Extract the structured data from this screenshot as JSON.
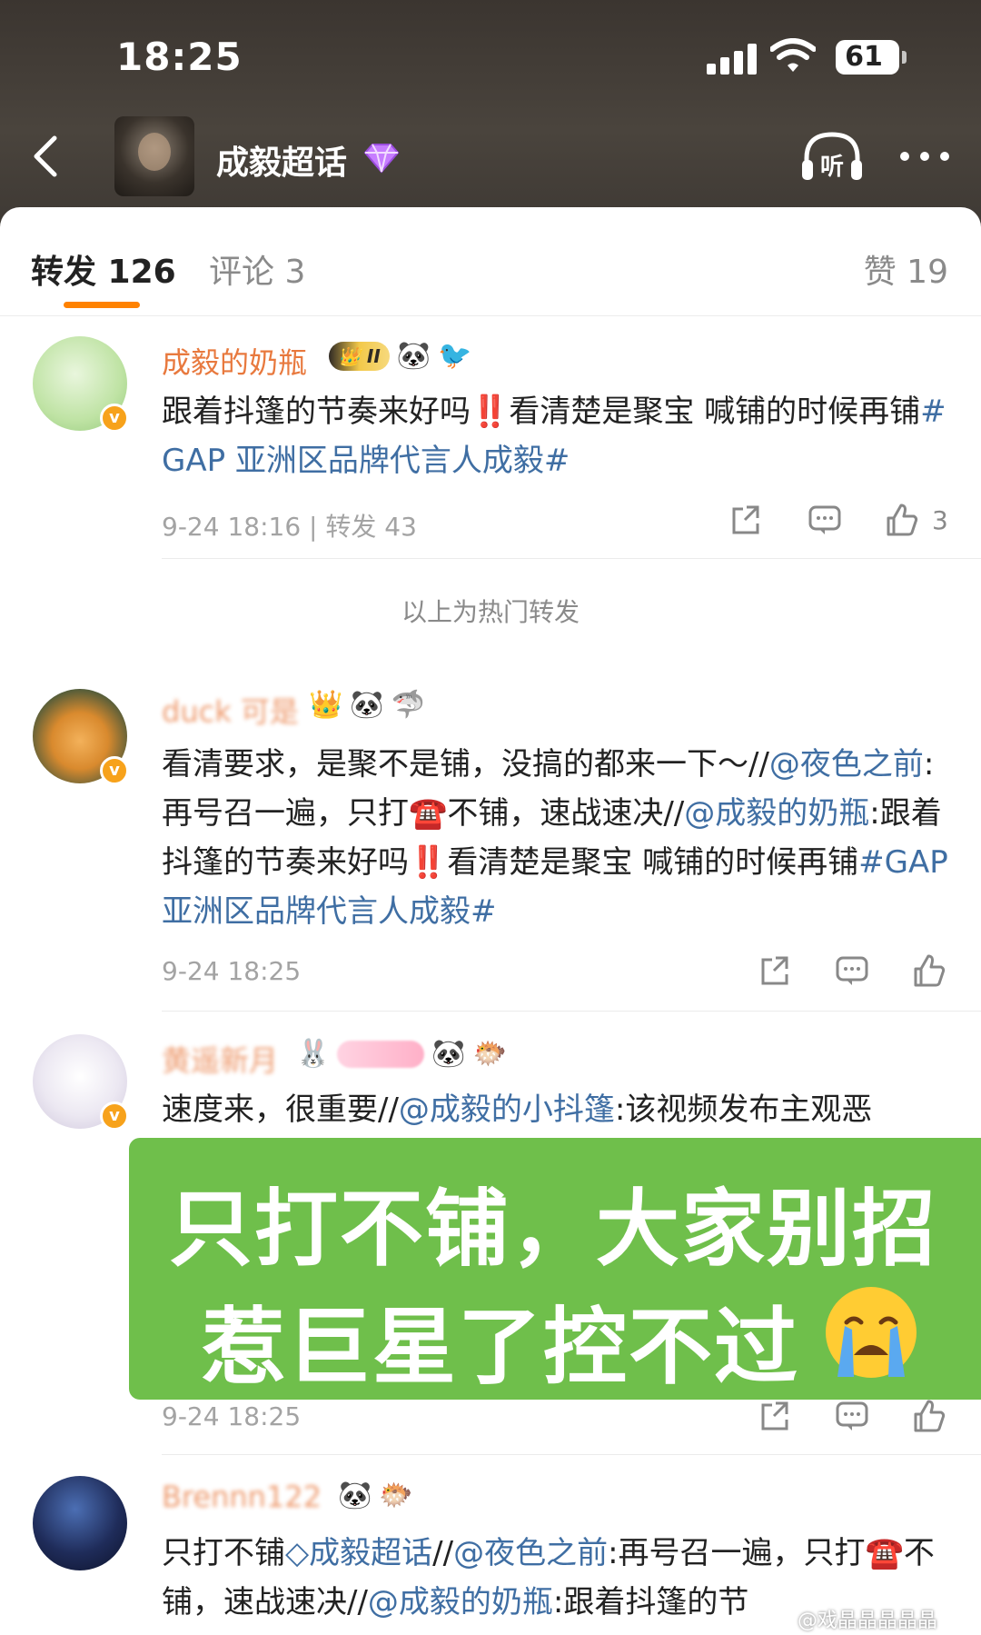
{
  "status_bar": {
    "time": "18:25",
    "battery": "61"
  },
  "nav": {
    "title": "成毅超话",
    "listen_label": "听"
  },
  "tabs": {
    "repost": "转发 126",
    "comment": "评论 3",
    "like": "赞 19"
  },
  "hot_divider": "以上为热门转发",
  "posts": [
    {
      "username": "成毅的奶瓶",
      "badge_level": "II",
      "text_parts": [
        "跟着抖篷的节奏来好吗",
        "‼️",
        "看清楚是聚宝 喊铺的时候再铺",
        "#GAP 亚洲区品牌代言人成毅#"
      ],
      "time": "9-24 18:16",
      "reposts": "转发 43",
      "likes": "3"
    },
    {
      "username": "duck 可是",
      "text_parts": [
        "看清要求，是聚不是铺，没搞的都来一下～//",
        "@夜色之前",
        ":再号召一遍，只打",
        "☎️",
        "不铺，速战速决//",
        "@成毅的奶瓶",
        ":跟着抖篷的节奏来好吗",
        "‼️",
        "看清楚是聚宝 喊铺的时候再铺",
        "#GAP 亚洲区品牌代言人成毅#"
      ],
      "time": "9-24 18:25"
    },
    {
      "username": "黄遥新月",
      "text_parts": [
        "速度来，很重要//",
        "@成毅的小抖篷",
        ":该视频发布主观恶"
      ],
      "time": "9-24 18:25"
    },
    {
      "username": "Brennn122",
      "text_parts": [
        "只打不铺",
        "成毅超话",
        "//",
        "@夜色之前",
        ":再号召一遍，只打",
        "☎️",
        "不铺，速战速决//",
        "@成毅的奶瓶",
        ":跟着抖篷的节"
      ]
    }
  ],
  "overlay": {
    "line1": "只打不铺，大家别招",
    "line2": "惹巨星了控不过"
  },
  "watermark": "@戏晶晶晶晶晶"
}
